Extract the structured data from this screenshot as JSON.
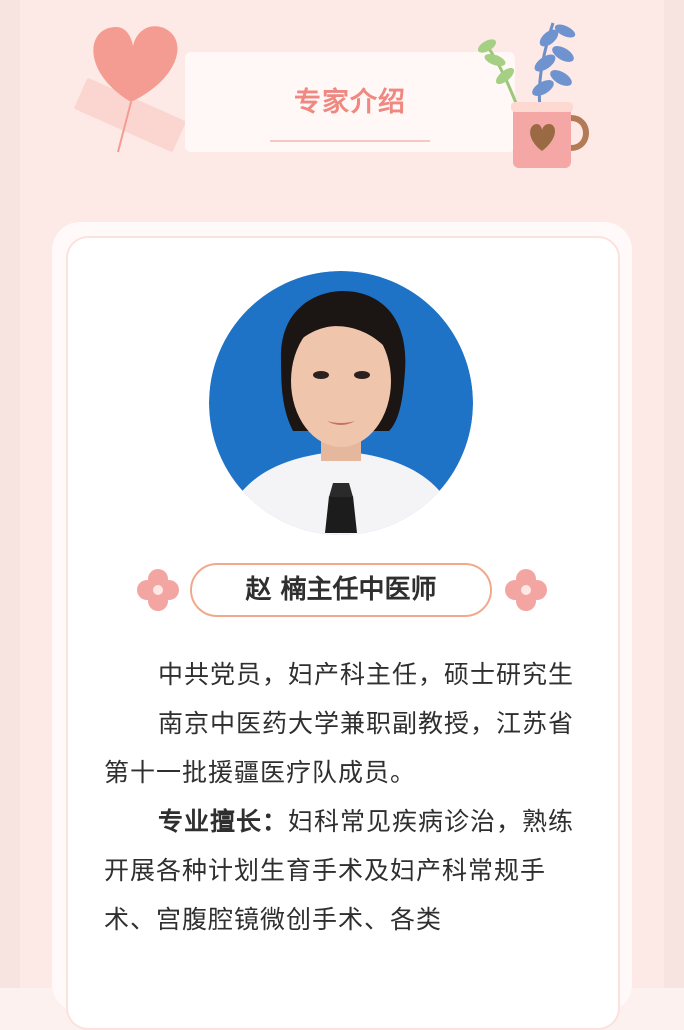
{
  "header": {
    "title": "专家介绍"
  },
  "profile": {
    "name": "赵 楠主任中医师",
    "photo_alt": "医生照片"
  },
  "bio": {
    "p1": "中共党员，妇产科主任，硕士研究生",
    "p2": "南京中医药大学兼职副教授，江苏省第十一批援疆医疗队成员。",
    "p3_label": "专业擅长：",
    "p3_text": "妇科常见疾病诊治，熟练开展各种计划生育手术及妇产科常规手术、宫腹腔镜微创手术、各类"
  },
  "colors": {
    "accent": "#ef8880",
    "pill_border": "#f1a98b",
    "background": "#fde9e6",
    "flower": "#f3a6a1"
  },
  "icons": [
    "heart-balloon-icon",
    "plant-mug-icon",
    "flower-icon"
  ]
}
